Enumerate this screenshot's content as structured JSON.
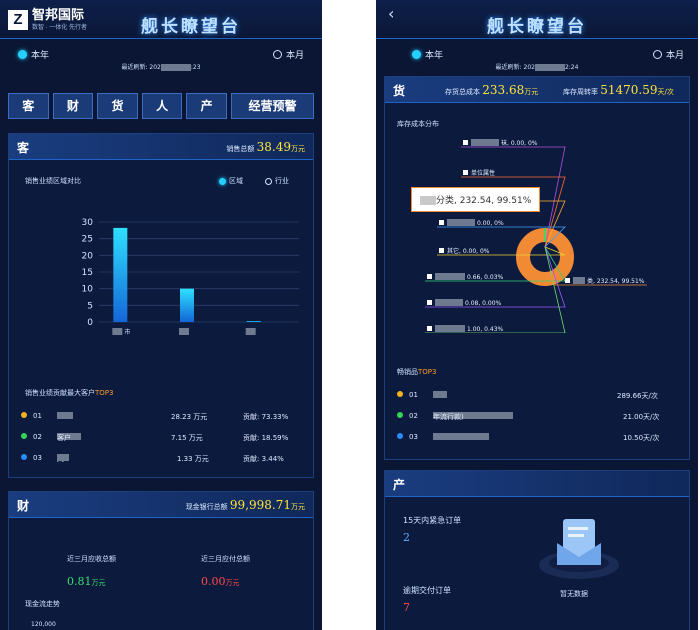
{
  "left": {
    "header": {
      "brand_name": "智邦国际",
      "brand_tagline": "数智 · 一体化 先行者",
      "title": "舰长瞭望台"
    },
    "period": {
      "option_year": "本年",
      "option_month": "本月",
      "refresh_label": "最近刷新:",
      "refresh_value_start": "202",
      "refresh_value_end": ":23"
    },
    "nav": [
      "客",
      "财",
      "货",
      "人",
      "产",
      "经营预警"
    ],
    "customer": {
      "title": "客",
      "total_label": "销售总额",
      "total_value": "38.49",
      "total_unit": "万元",
      "chart_title": "销售业绩区域对比",
      "legend_region": "区域",
      "legend_industry": "行业",
      "xlabel_suffix": "市",
      "top_title": "销售业绩贡献最大客户",
      "top_suffix": "TOP3",
      "top": [
        {
          "rank": "01",
          "name": "",
          "amount": "28.23 万元",
          "share": "贡献: 73.33%"
        },
        {
          "rank": "02",
          "name": "客户",
          "amount": "7.15 万元",
          "share": "贡献: 18.59%"
        },
        {
          "rank": "03",
          "name": "刘",
          "amount": "1.33 万元",
          "share": "贡献: 3.44%"
        }
      ]
    },
    "finance": {
      "title": "财",
      "total_label": "现金银行总额",
      "total_value": "99,998.71",
      "total_unit": "万元",
      "recv_label": "近三月应收总额",
      "recv_value": "0.81",
      "recv_unit": "万元",
      "pay_label": "近三月应付总额",
      "pay_value": "0.00",
      "pay_unit": "万元",
      "trend_title": "现金流走势",
      "trend_y_tick": "120,000"
    }
  },
  "right": {
    "header": {
      "title": "舰长瞭望台",
      "back_icon": "‹"
    },
    "period": {
      "option_year": "本年",
      "option_month": "本月",
      "refresh_label": "最近刷新:",
      "refresh_value_start": "202",
      "refresh_value_end": "2:24"
    },
    "goods": {
      "title": "货",
      "cost_label": "存货总成本",
      "cost_value": "233.68",
      "cost_unit": "万元",
      "turnover_label": "库存周转率",
      "turnover_value": "51470.59",
      "turnover_unit": "天/次",
      "dist_title": "库存成本分布",
      "tooltip": "分类, 232.54, 99.51%",
      "pie_labels": [
        "袜, 0.00, 0%",
        "单位属性",
        "0.00, 0%",
        "0.00, 0%",
        "其它, 0.00, 0%",
        "0.66, 0.03%",
        "0.08, 0.00%",
        "1.00, 0.43%",
        "类, 232.54, 99.51%"
      ],
      "hot_title": "畅销品",
      "hot_suffix": "TOP3",
      "hot": [
        {
          "rank": "01",
          "name": "",
          "value": "289.66天/次"
        },
        {
          "rank": "02",
          "name": "年流行款)",
          "value": "21.00天/次"
        },
        {
          "rank": "03",
          "name": "",
          "value": "10.50天/次"
        }
      ]
    },
    "production": {
      "title": "产",
      "urgent_label": "15天内紧急订单",
      "urgent_value": "2",
      "overdue_label": "逾期交付订单",
      "overdue_value": "7",
      "empty_text": "暂无数据"
    }
  },
  "chart_data": [
    {
      "type": "bar",
      "title": "销售业绩区域对比",
      "categories": [
        "市",
        "",
        ""
      ],
      "values": [
        28.23,
        10.0,
        0.3
      ],
      "yticks": [
        0,
        5,
        10,
        15,
        20,
        25,
        30
      ],
      "ylim": [
        0,
        30
      ],
      "color": "#19b8ff"
    },
    {
      "type": "pie",
      "title": "库存成本分布",
      "slices": [
        {
          "label": "分类",
          "value": 232.54,
          "percent": 99.51
        },
        {
          "label": "",
          "value": 1.0,
          "percent": 0.43
        },
        {
          "label": "",
          "value": 0.66,
          "percent": 0.03
        },
        {
          "label": "",
          "value": 0.08,
          "percent": 0.0
        }
      ],
      "color": "#f08a35"
    }
  ]
}
